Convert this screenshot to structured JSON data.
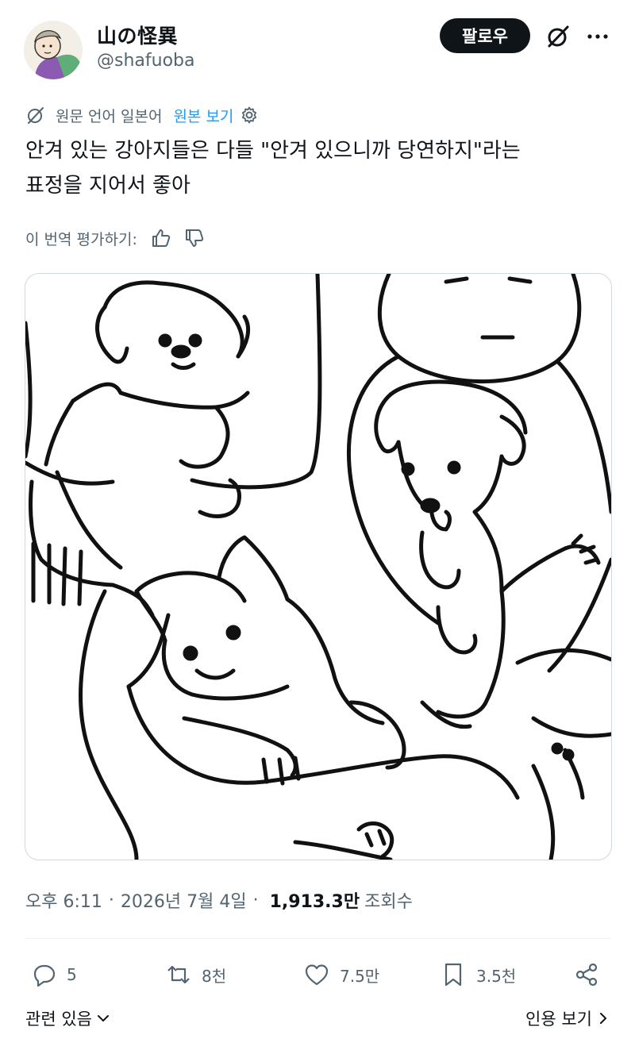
{
  "author": {
    "display_name": "山の怪異",
    "handle": "@shafuoba",
    "avatar": "illustrated-avatar"
  },
  "header": {
    "follow_label": "팔로우",
    "grok_icon": "slashed-circle-icon",
    "more_icon": "ellipsis-icon"
  },
  "translation": {
    "note": "원문 언어 일본어",
    "show_original": "원본 보기",
    "icon": "translate-icon",
    "settings_icon": "gear-icon"
  },
  "tweet": {
    "line1": "안겨 있는 강아지들은 다들 \"안겨 있으니까 당연하지\"라는",
    "line2": "표정을 지어서 좋아"
  },
  "rating": {
    "label": "이 번역 평가하기:",
    "up_icon": "thumbs-up-icon",
    "down_icon": "thumbs-down-icon"
  },
  "meta": {
    "time": "오후 6:11",
    "sep1": "·",
    "date": "2026년 7월 4일",
    "sep2": "·",
    "views": "1,913.3만",
    "views_label": "조회수"
  },
  "actions": {
    "reply_count": "5",
    "repost_count": "8천",
    "like_count": "7.5만",
    "bookmark_count": "3.5천",
    "share_icon": "share-icon"
  },
  "footer": {
    "related": "관련 있음",
    "quotes": "인용 보기"
  },
  "colors": {
    "text": "#0f1419",
    "secondary": "#536471",
    "link": "#1d9bf0",
    "button_bg": "#0f1419",
    "border": "#cfd9de"
  }
}
